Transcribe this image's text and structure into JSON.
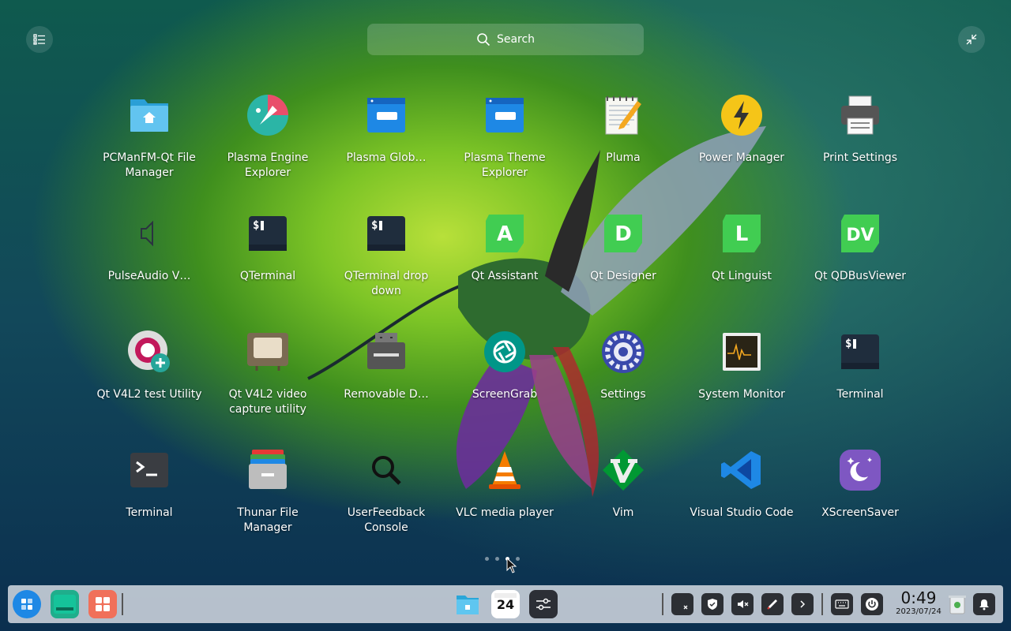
{
  "search": {
    "label": "Search"
  },
  "apps": [
    {
      "name": "app-pcmanfm-qt",
      "label": "PCManFM-Qt File Manager",
      "icon": "folder-home-icon"
    },
    {
      "name": "app-plasma-engine-explorer",
      "label": "Plasma Engine Explorer",
      "icon": "plasma-engine-icon"
    },
    {
      "name": "app-plasma-global",
      "label": "Plasma Glob…",
      "icon": "window-icon"
    },
    {
      "name": "app-plasma-theme-explorer",
      "label": "Plasma Theme Explorer",
      "icon": "window-icon"
    },
    {
      "name": "app-pluma",
      "label": "Pluma",
      "icon": "notepad-pencil-icon"
    },
    {
      "name": "app-power-manager",
      "label": "Power Manager",
      "icon": "lightning-icon"
    },
    {
      "name": "app-print-settings",
      "label": "Print Settings",
      "icon": "printer-icon"
    },
    {
      "name": "app-pulseaudio",
      "label": "PulseAudio V…",
      "icon": "speaker-icon"
    },
    {
      "name": "app-qterminal",
      "label": "QTerminal",
      "icon": "terminal-icon"
    },
    {
      "name": "app-qterminal-dropdown",
      "label": "QTerminal drop down",
      "icon": "terminal-icon"
    },
    {
      "name": "app-qt-assistant",
      "label": "Qt Assistant",
      "icon": "qt-letter-icon",
      "letter": "A"
    },
    {
      "name": "app-qt-designer",
      "label": "Qt Designer",
      "icon": "qt-letter-icon",
      "letter": "D"
    },
    {
      "name": "app-qt-linguist",
      "label": "Qt Linguist",
      "icon": "qt-letter-icon",
      "letter": "L"
    },
    {
      "name": "app-qdbusviewer",
      "label": "Qt QDBusViewer",
      "icon": "qt-letter-icon",
      "letter": "DV"
    },
    {
      "name": "app-qt-v4l2-test",
      "label": "Qt V4L2 test Utility",
      "icon": "webcam-gear-icon"
    },
    {
      "name": "app-qt-v4l2-video",
      "label": "Qt V4L2 video capture utility",
      "icon": "tv-icon"
    },
    {
      "name": "app-removable-drives",
      "label": "Removable D…",
      "icon": "drive-icon"
    },
    {
      "name": "app-screengrab",
      "label": "ScreenGrab",
      "icon": "camera-aperture-icon"
    },
    {
      "name": "app-settings",
      "label": "Settings",
      "icon": "settings-gear-icon"
    },
    {
      "name": "app-system-monitor",
      "label": "System Monitor",
      "icon": "monitor-graph-icon"
    },
    {
      "name": "app-terminal-1",
      "label": "Terminal",
      "icon": "terminal-icon"
    },
    {
      "name": "app-terminal-2",
      "label": "Terminal",
      "icon": "terminal-prompt-icon"
    },
    {
      "name": "app-thunar",
      "label": "Thunar File Manager",
      "icon": "file-cabinet-icon"
    },
    {
      "name": "app-userfeedback",
      "label": "UserFeedback Console",
      "icon": "magnifier-icon"
    },
    {
      "name": "app-vlc",
      "label": "VLC media player",
      "icon": "vlc-cone-icon"
    },
    {
      "name": "app-vim",
      "label": "Vim",
      "icon": "vim-icon"
    },
    {
      "name": "app-vscode",
      "label": "Visual Studio Code",
      "icon": "vscode-icon"
    },
    {
      "name": "app-xscreensaver",
      "label": "XScreenSaver",
      "icon": "moon-stars-icon"
    }
  ],
  "pager": {
    "pages": 4,
    "active": 3
  },
  "clock": {
    "time": "0:49",
    "date": "2023/07/24"
  },
  "calendar_day": "24",
  "colors": {
    "qt_green": "#41cd52",
    "accent_blue": "#1e88e5"
  }
}
